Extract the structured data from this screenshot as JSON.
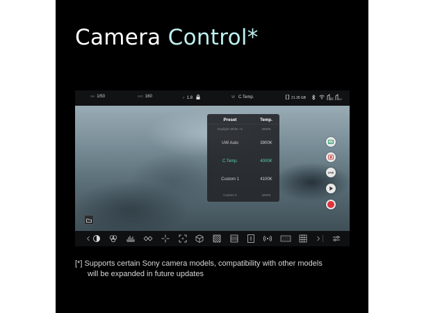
{
  "title": {
    "word1": "Camera",
    "word2": "Control*"
  },
  "status_bar": {
    "shutter_label": "SH",
    "shutter_value": "1/50",
    "iso_label": "ISO",
    "iso_value": "160",
    "iris_label": "F",
    "iris_value": "1.8",
    "wb_mode": "C.Temp.",
    "storage": "21.35 GB"
  },
  "preset_panel": {
    "header_preset": "Preset",
    "header_temp": "Temp.",
    "rows": [
      {
        "name": "Daylight White +1",
        "temp": "3800K"
      },
      {
        "name": "UW Auto",
        "temp": "3900K"
      },
      {
        "name": "C.Temp.",
        "temp": "4000K"
      },
      {
        "name": "Custom 1",
        "temp": "4100K"
      },
      {
        "name": "Custom 2",
        "temp": "4200K"
      }
    ],
    "selected_index": 2
  },
  "right_controls": {
    "live_label": "LIVE"
  },
  "footnote": {
    "line1": "[*] Supports certain Sony camera models, compatibility with other models",
    "line2": "will be expanded in future updates"
  },
  "colors": {
    "title_accent": "#bfeff0",
    "selected_row": "#5fd0a6",
    "record": "#e0323a"
  },
  "toolbar_icons": [
    "chevron-left-icon",
    "exposure-icon",
    "color-wheels-icon",
    "histogram-icon",
    "waveform-icon",
    "crosshair-icon",
    "frame-guide-icon",
    "cube-lut-icon",
    "zebra-icon",
    "grid-lines-icon",
    "anamorphic-icon",
    "wireless-icon",
    "timecode-icon",
    "grid-icon",
    "chevron-right-icon",
    "sliders-icon"
  ]
}
